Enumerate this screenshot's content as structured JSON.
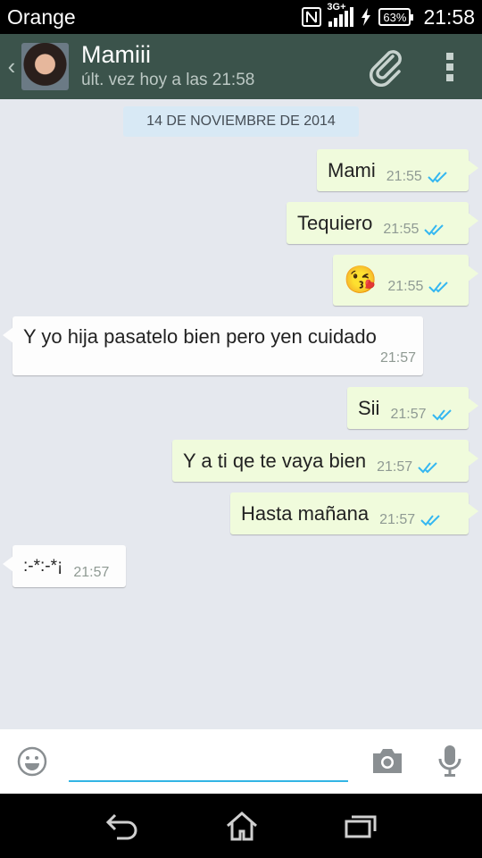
{
  "status_bar": {
    "carrier": "Orange",
    "network": "3G+",
    "battery": "63%",
    "time": "21:58"
  },
  "header": {
    "back_icon": "chevron-left-icon",
    "contact_name": "Mamiii",
    "last_seen": "últ. vez hoy a las 21:58",
    "attach_icon": "paperclip-icon",
    "menu_icon": "overflow-menu-icon"
  },
  "chat": {
    "date": "14 DE NOVIEMBRE DE 2014",
    "messages": [
      {
        "direction": "outgoing",
        "text": "Mami",
        "time": "21:55",
        "status": "read"
      },
      {
        "direction": "outgoing",
        "text": "Tequiero",
        "time": "21:55",
        "status": "read"
      },
      {
        "direction": "outgoing",
        "text": "😘",
        "time": "21:55",
        "status": "read"
      },
      {
        "direction": "incoming",
        "text": "Y yo hija pasatelo bien pero yen cuidado",
        "time": "21:57"
      },
      {
        "direction": "outgoing",
        "text": "Sii",
        "time": "21:57",
        "status": "read"
      },
      {
        "direction": "outgoing",
        "text": "Y a ti qe te vaya bien",
        "time": "21:57",
        "status": "read"
      },
      {
        "direction": "outgoing",
        "text": "Hasta mañana",
        "time": "21:57",
        "status": "read"
      },
      {
        "direction": "incoming",
        "text": ":-*:-*¡",
        "time": "21:57"
      }
    ]
  },
  "composer": {
    "emoji_icon": "emoji-icon",
    "input_value": "",
    "camera_icon": "camera-icon",
    "mic_icon": "microphone-icon"
  },
  "nav_bar": {
    "back_icon": "back-icon",
    "home_icon": "home-icon",
    "recents_icon": "recent-apps-icon"
  },
  "colors": {
    "header": "#3b534b",
    "chat_bg": "#e5e8ee",
    "outgoing_bubble": "#f0fbdc",
    "incoming_bubble": "#fdfdfd",
    "read_ticks": "#34b7f1",
    "input_underline": "#33b5e5"
  }
}
